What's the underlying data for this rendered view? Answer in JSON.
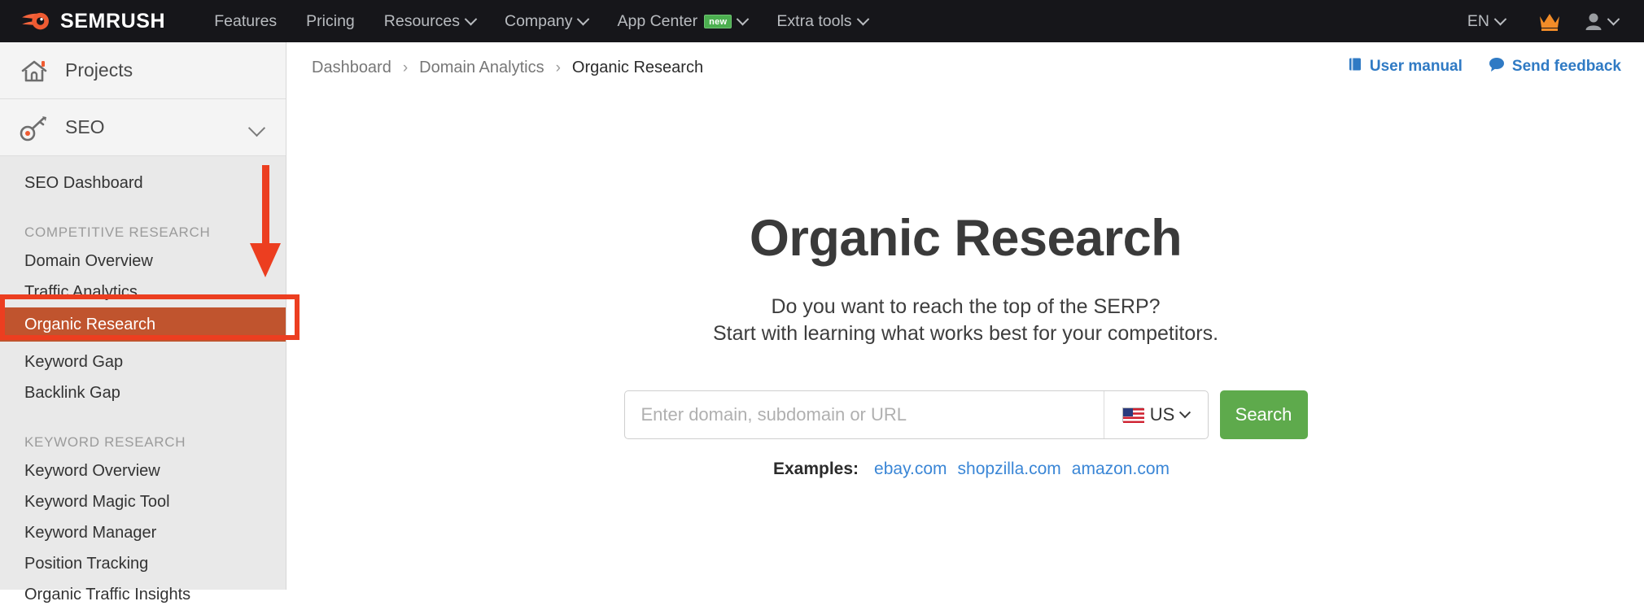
{
  "topnav": {
    "brand": "SEMRUSH",
    "brand_logo_icon": "semrush-flame-icon",
    "items": [
      {
        "label": "Features",
        "caret": false,
        "badge": null
      },
      {
        "label": "Pricing",
        "caret": false,
        "badge": null
      },
      {
        "label": "Resources",
        "caret": true,
        "badge": null
      },
      {
        "label": "Company",
        "caret": true,
        "badge": null
      },
      {
        "label": "App Center",
        "caret": true,
        "badge": "new"
      },
      {
        "label": "Extra tools",
        "caret": true,
        "badge": null
      }
    ],
    "language": "EN",
    "crown_icon": "crown-icon",
    "account_icon": "user-avatar-icon"
  },
  "sidebar": {
    "projects": {
      "label": "Projects",
      "icon": "home-icon"
    },
    "seo": {
      "label": "SEO",
      "icon": "key-icon",
      "chevron": "chevron-down-icon"
    },
    "links": [
      {
        "type": "link",
        "label": "SEO Dashboard",
        "active": false
      },
      {
        "type": "group",
        "label": "COMPETITIVE RESEARCH"
      },
      {
        "type": "link",
        "label": "Domain Overview",
        "active": false
      },
      {
        "type": "link",
        "label": "Traffic Analytics",
        "active": false
      },
      {
        "type": "link",
        "label": "Organic Research",
        "active": true
      },
      {
        "type": "link",
        "label": "Keyword Gap",
        "active": false
      },
      {
        "type": "link",
        "label": "Backlink Gap",
        "active": false
      },
      {
        "type": "group",
        "label": "KEYWORD RESEARCH"
      },
      {
        "type": "link",
        "label": "Keyword Overview",
        "active": false
      },
      {
        "type": "link",
        "label": "Keyword Magic Tool",
        "active": false
      },
      {
        "type": "link",
        "label": "Keyword Manager",
        "active": false
      },
      {
        "type": "link",
        "label": "Position Tracking",
        "active": false
      },
      {
        "type": "link",
        "label": "Organic Traffic Insights",
        "active": false
      }
    ]
  },
  "annotations": {
    "arrow_icon": "red-down-arrow-annotation",
    "box_icon": "red-highlight-box-annotation",
    "color": "#ec3e20"
  },
  "breadcrumb": {
    "items": [
      "Dashboard",
      "Domain Analytics",
      "Organic Research"
    ],
    "separator": "›"
  },
  "top_links": [
    {
      "label": "User manual",
      "icon": "book-icon"
    },
    {
      "label": "Send feedback",
      "icon": "speech-bubble-icon"
    }
  ],
  "hero": {
    "title": "Organic Research",
    "subtitle_line1": "Do you want to reach the top of the SERP?",
    "subtitle_line2": "Start with learning what works best for your competitors."
  },
  "search": {
    "placeholder": "Enter domain, subdomain or URL",
    "value": "",
    "database": "US",
    "database_flag": "us-flag-icon",
    "button_label": "Search"
  },
  "examples": {
    "label": "Examples:",
    "links": [
      "ebay.com",
      "shopzilla.com",
      "amazon.com"
    ]
  },
  "colors": {
    "nav_bg": "#16161a",
    "sidebar_bg": "#e9e9e9",
    "active_item": "#c0542e",
    "search_button": "#5eaa4c",
    "link_blue": "#3a86d6",
    "annotation_red": "#ec3e20"
  }
}
